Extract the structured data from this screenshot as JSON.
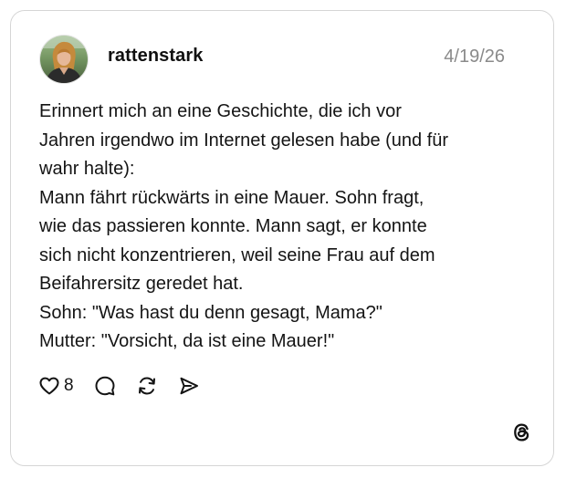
{
  "post": {
    "username": "rattenstark",
    "date": "4/19/26",
    "text_lines": [
      "Erinnert mich an eine Geschichte, die ich vor",
      "Jahren irgendwo im Internet gelesen habe (und für",
      "wahr halte):",
      "Mann fährt rückwärts in eine Mauer. Sohn fragt,",
      "wie das passieren konnte. Mann sagt, er konnte",
      "sich nicht konzentrieren, weil seine Frau auf dem",
      "Beifahrersitz geredet hat.",
      "Sohn: \"Was hast du denn gesagt, Mama?\"",
      "Mutter: \"Vorsicht, da ist eine Mauer!\""
    ],
    "like_count": "8"
  },
  "icons": {
    "avatar": "user-avatar-photo",
    "like": "heart-icon",
    "comment": "speech-bubble-icon",
    "repost": "repost-icon",
    "share": "send-icon",
    "brand": "threads-logo-icon"
  },
  "colors": {
    "text": "#141414",
    "muted": "#8a8a8a",
    "border": "#d6d6d6",
    "background": "#ffffff"
  }
}
